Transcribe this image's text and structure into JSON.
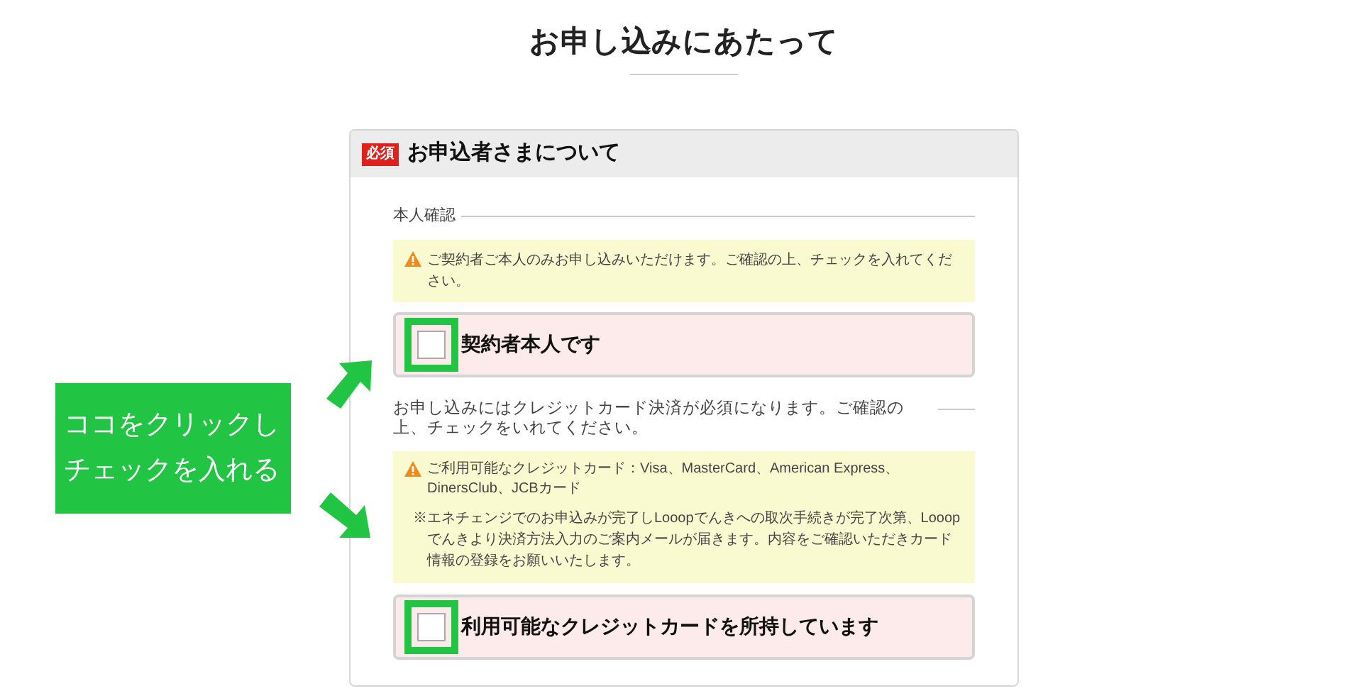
{
  "page": {
    "title": "お申し込みにあたって"
  },
  "section": {
    "required_badge": "必須",
    "title": "お申込者さまについて",
    "identity": {
      "legend": "本人確認",
      "notice": "ご契約者ご本人のみお申し込みいただけます。ご確認の上、チェックを入れてください。",
      "checkbox": {
        "label": "契約者本人です",
        "checked": false,
        "highlighted": true
      }
    },
    "credit": {
      "description": "お申し込みにはクレジットカード決済が必須になります。ご確認の上、チェックをいれてください。",
      "notice": "ご利用可能なクレジットカード：Visa、MasterCard、American Express、DinersClub、JCBカード",
      "note": "※エネチェンジでのお申込みが完了しLooopでんきへの取次手続きが完了次第、Looopでんきより決済方法入力のご案内メールが届きます。内容をご確認いただきカード情報の登録をお願いいたします。",
      "checkbox": {
        "label": "利用可能なクレジットカードを所持しています",
        "checked": false,
        "highlighted": true
      }
    }
  },
  "callout": {
    "lines": [
      "ココをクリックし",
      "チェックを入れる"
    ]
  }
}
